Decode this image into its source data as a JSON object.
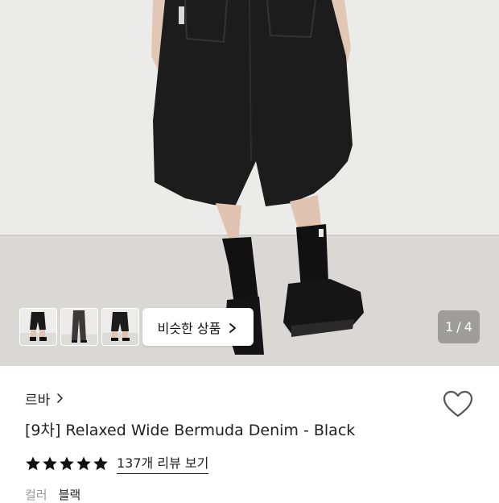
{
  "gallery": {
    "similar_button_label": "비슷한 상품",
    "current_index": "1",
    "separator": "/",
    "total": "4",
    "thumbnails": [
      "thumbnail-1",
      "thumbnail-2",
      "thumbnail-3"
    ]
  },
  "product": {
    "brand": "르바",
    "title": "[9차] Relaxed Wide Bermuda Denim - Black",
    "rating_stars": 5,
    "review_link": "137개 리뷰 보기",
    "option_label": "컬러",
    "option_value": "블랙"
  },
  "icons": {
    "wishlist": "heart-outline-icon",
    "brand_arrow": "chevron-right-icon",
    "star": "star-filled-icon"
  },
  "colors": {
    "star": "#111111",
    "counter_bg": "#8a8a8a",
    "denim": "#1b1b1b"
  }
}
